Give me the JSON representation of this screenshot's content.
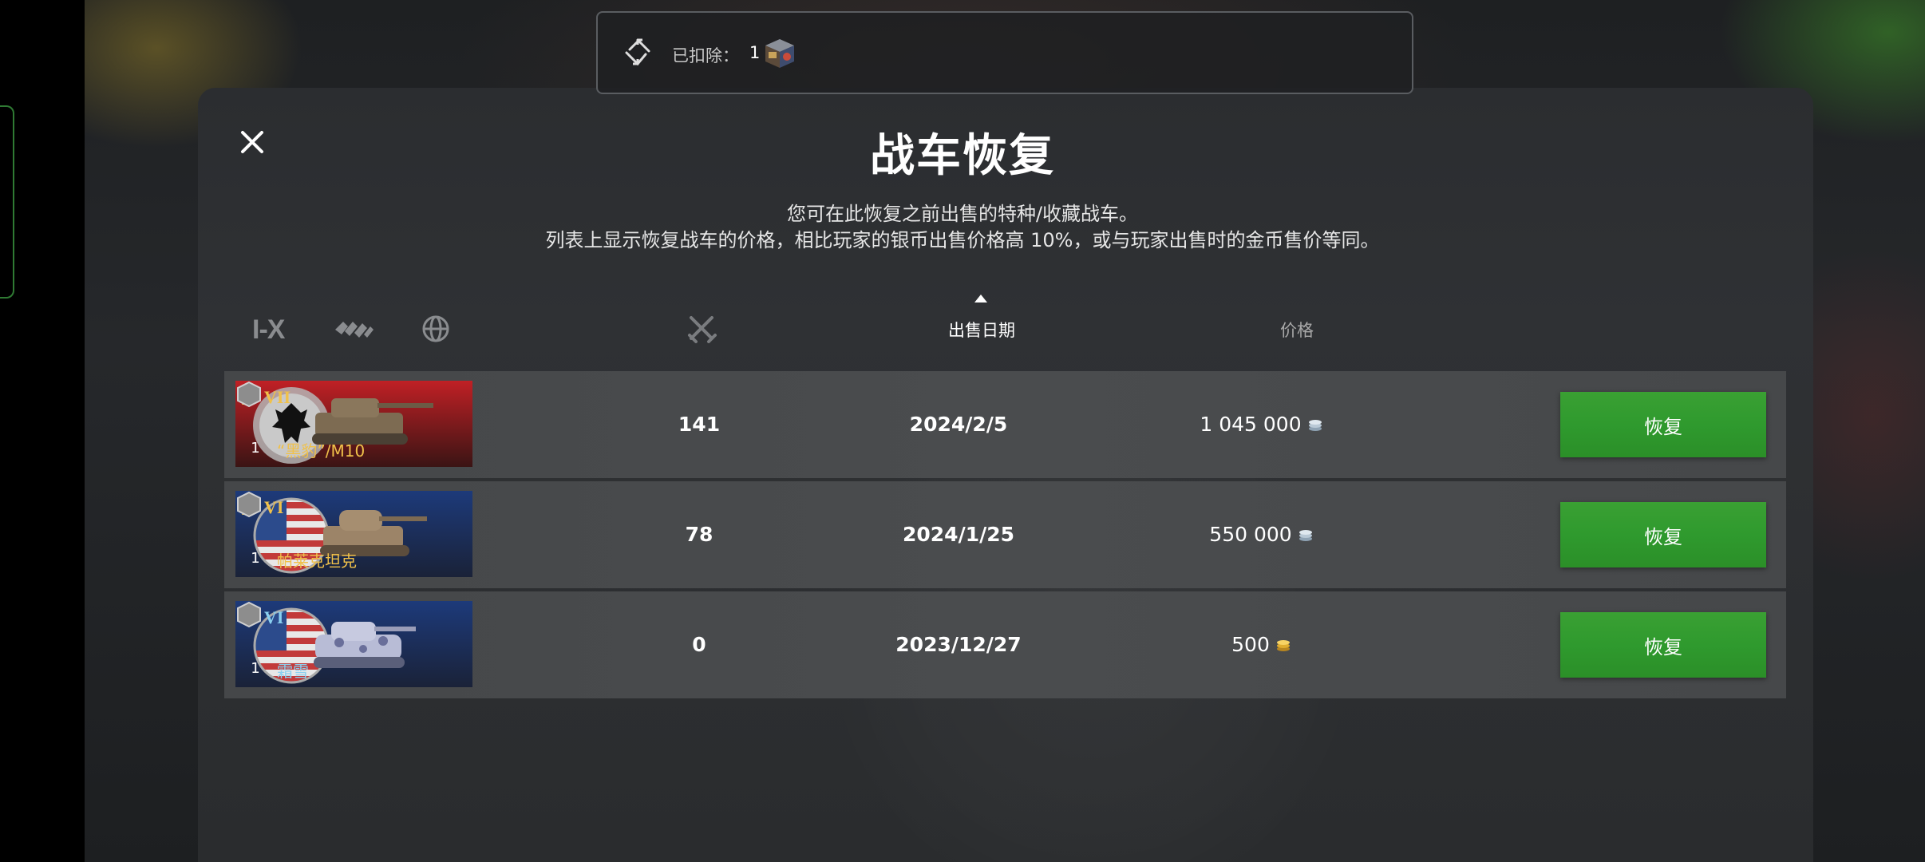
{
  "deducted": {
    "label": "已扣除：",
    "count": "1",
    "icon": "supply-crate-icon"
  },
  "dialog": {
    "title": "战车恢复",
    "description_line1": "您可在此恢复之前出售的特种/收藏战车。",
    "description_line2": "列表上显示恢复战车的价格，相比玩家的银币出售价格高 10%，或与玩家出售时的金币售价等同。"
  },
  "filters": {
    "tier_label": "I-X",
    "type_icon": "vehicle-type-icon",
    "nation_icon": "globe-icon"
  },
  "columns": {
    "battles_icon": "crossed-swords-icon",
    "date": "出售日期",
    "price": "价格"
  },
  "vehicles": [
    {
      "tier": "VII",
      "name": "“黑豹”/M10",
      "mastery": "1",
      "battles": "141",
      "sold_date": "2024/2/5",
      "price": "1 045 000",
      "currency": "silver",
      "restore_label": "恢复",
      "nation": "germany"
    },
    {
      "tier": "VI",
      "name": "帕莱克坦克",
      "mastery": "1",
      "battles": "78",
      "sold_date": "2024/1/25",
      "price": "550 000",
      "currency": "silver",
      "restore_label": "恢复",
      "nation": "usa"
    },
    {
      "tier": "VI",
      "name": "霜雪",
      "mastery": "1",
      "battles": "0",
      "sold_date": "2023/12/27",
      "price": "500",
      "currency": "gold",
      "restore_label": "恢复",
      "nation": "usa"
    }
  ],
  "colors": {
    "restore_button": "#2f9a2e",
    "premium_name": "#f0c14a",
    "collector_name": "#8ad0f0"
  }
}
